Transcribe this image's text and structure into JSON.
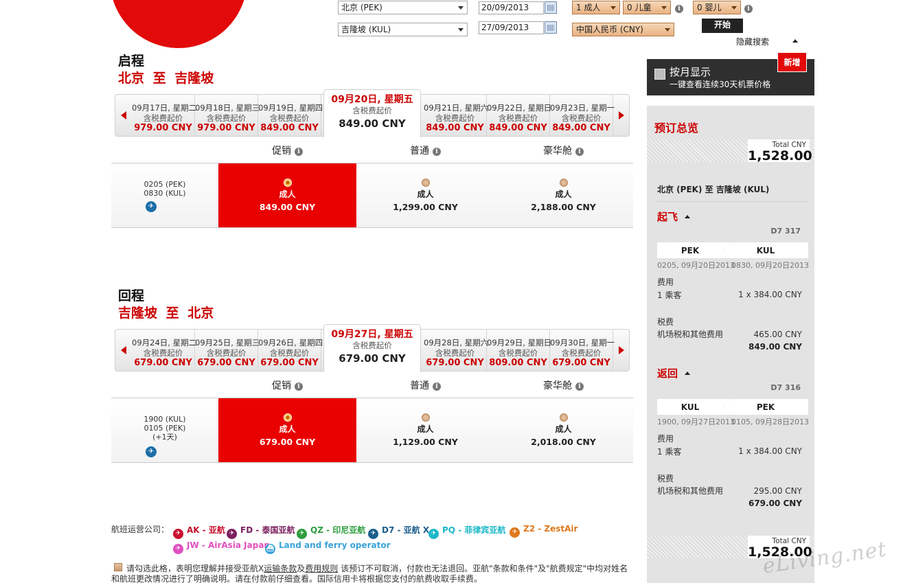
{
  "search": {
    "origin": "北京 (PEK)",
    "destination": "吉隆坡 (KUL)",
    "depart_date": "20/09/2013",
    "return_date": "27/09/2013",
    "adults": "1 成人",
    "children": "0 儿童",
    "infants": "0 婴儿",
    "currency": "中国人民币 (CNY)",
    "go_label": "开始",
    "hide_label": "隐藏搜索"
  },
  "outbound": {
    "title": "启程",
    "route": "北京 至 吉隆坡",
    "days": [
      {
        "date": "09月17日, 星期二",
        "tax": "含税费起价",
        "price": "979.00 CNY"
      },
      {
        "date": "09月18日, 星期三",
        "tax": "含税费起价",
        "price": "979.00 CNY"
      },
      {
        "date": "09月19日, 星期四",
        "tax": "含税费起价",
        "price": "849.00 CNY"
      },
      {
        "date": "09月20日, 星期五",
        "tax": "含税费起价",
        "price": "849.00 CNY"
      },
      {
        "date": "09月21日, 星期六",
        "tax": "含税费起价",
        "price": "849.00 CNY"
      },
      {
        "date": "09月22日, 星期日",
        "tax": "含税费起价",
        "price": "849.00 CNY"
      },
      {
        "date": "09月23日, 星期一",
        "tax": "含税费起价",
        "price": "849.00 CNY"
      }
    ],
    "classes": [
      "促销",
      "普通",
      "豪华舱"
    ],
    "flight": {
      "dep": "0205 (PEK)",
      "arr": "0830 (KUL)",
      "extra": ""
    },
    "fares": [
      {
        "who": "成人",
        "amt": "849.00 CNY",
        "selected": true
      },
      {
        "who": "成人",
        "amt": "1,299.00 CNY",
        "selected": false
      },
      {
        "who": "成人",
        "amt": "2,188.00 CNY",
        "selected": false
      }
    ]
  },
  "inbound": {
    "title": "回程",
    "route": "吉隆坡 至 北京",
    "days": [
      {
        "date": "09月24日, 星期二",
        "tax": "含税费起价",
        "price": "679.00 CNY"
      },
      {
        "date": "09月25日, 星期三",
        "tax": "含税费起价",
        "price": "679.00 CNY"
      },
      {
        "date": "09月26日, 星期四",
        "tax": "含税费起价",
        "price": "679.00 CNY"
      },
      {
        "date": "09月27日, 星期五",
        "tax": "含税费起价",
        "price": "679.00 CNY"
      },
      {
        "date": "09月28日, 星期六",
        "tax": "含税费起价",
        "price": "679.00 CNY"
      },
      {
        "date": "09月29日, 星期日",
        "tax": "含税费起价",
        "price": "809.00 CNY"
      },
      {
        "date": "09月30日, 星期一",
        "tax": "含税费起价",
        "price": "679.00 CNY"
      }
    ],
    "classes": [
      "促销",
      "普通",
      "豪华舱"
    ],
    "flight": {
      "dep": "1900 (KUL)",
      "arr": "0105 (PEK)",
      "extra": "(+1天)"
    },
    "fares": [
      {
        "who": "成人",
        "amt": "679.00 CNY",
        "selected": true
      },
      {
        "who": "成人",
        "amt": "1,129.00 CNY",
        "selected": false
      },
      {
        "who": "成人",
        "amt": "2,018.00 CNY",
        "selected": false
      }
    ]
  },
  "carriers": {
    "label": "航班运营公司：",
    "items": [
      {
        "code": "AK - 亚航",
        "color": "#c8102e"
      },
      {
        "code": "FD - 泰国亚航",
        "color": "#7b1f5e"
      },
      {
        "code": "QZ - 印尼亚航",
        "color": "#2e9e3e"
      },
      {
        "code": "D7 - 亚航 X",
        "color": "#1b5e8c"
      },
      {
        "code": "PQ - 菲律宾亚航",
        "color": "#1cb8c8"
      },
      {
        "code": "Z2 - ZestAir",
        "color": "#e0781c"
      },
      {
        "code": "JW - AirAsia Japan",
        "color": "#e04fbf"
      },
      {
        "code": "Land and ferry operator",
        "color": "#3aa3d8"
      }
    ]
  },
  "legal": {
    "line1_a": "请勾选此格，表明您理解并接受亚航X",
    "link1": "运输条款",
    "and": "及",
    "link2": "费用规则",
    "line1_b": " 该预订不可取消，付款也无法退回。亚航\"条款和条件\"及\"航费规定\"中均对姓名",
    "line2": "和航班更改情况进行了明确说明。请在付款前仔细查看。国际信用卡将根据您支付的航费收取手续费。"
  },
  "monthly": {
    "title": "按月显示",
    "subtitle": "一键查看连续30天机票价格",
    "badge": "新增"
  },
  "summary": {
    "title": "预订总览",
    "total_label": "Total CNY",
    "total": "1,528.00",
    "route": "北京 (PEK) 至 吉隆坡 (KUL)",
    "depart": {
      "title": "起飞",
      "flight_no": "D7 317",
      "from": "PEK",
      "to": "KUL",
      "from_time": "0205, 09月20日2013",
      "to_time": "0830, 09月20日2013",
      "fee_label": "费用",
      "pax": "1 乘客",
      "fare": "1 x 384.00 CNY",
      "tax_label": "税费",
      "tax_item": "机场税和其他费用",
      "tax": "465.00 CNY",
      "subtotal": "849.00 CNY"
    },
    "return": {
      "title": "返回",
      "flight_no": "D7 316",
      "from": "KUL",
      "to": "PEK",
      "from_time": "1900, 09月27日2013",
      "to_time": "0105, 09月28日2013",
      "fee_label": "费用",
      "pax": "1 乘客",
      "fare": "1 x 384.00 CNY",
      "tax_label": "税费",
      "tax_item": "机场税和其他费用",
      "tax": "295.00 CNY",
      "subtotal": "679.00 CNY"
    }
  },
  "watermark": "eLiving.net"
}
